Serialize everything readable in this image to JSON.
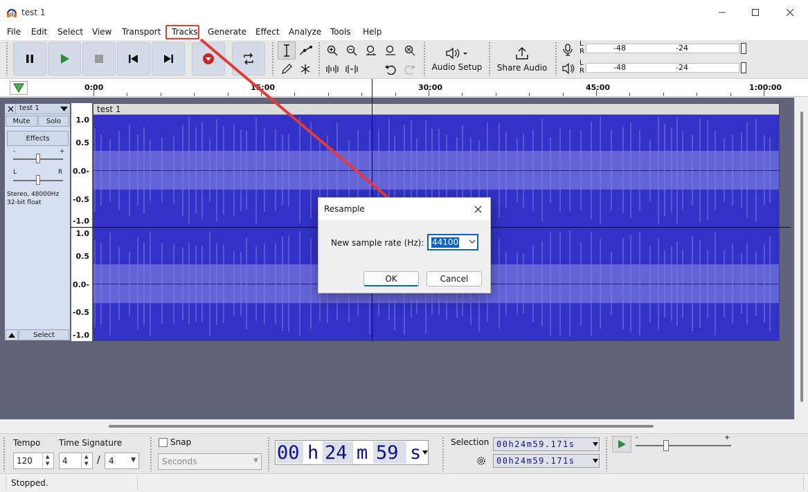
{
  "window": {
    "title": "test 1"
  },
  "menu": [
    "File",
    "Edit",
    "Select",
    "View",
    "Transport",
    "Tracks",
    "Generate",
    "Effect",
    "Analyze",
    "Tools",
    "Help"
  ],
  "toolbar": {
    "audio_setup_label": "Audio Setup",
    "share_audio_label": "Share Audio",
    "record_meter": {
      "channels": [
        "L",
        "R"
      ],
      "ticks": [
        "-48",
        "-24"
      ]
    },
    "play_meter": {
      "channels": [
        "L",
        "R"
      ],
      "ticks": [
        "-48",
        "-24"
      ]
    }
  },
  "ruler": {
    "labels": [
      "0:00",
      "15:00",
      "30:00",
      "45:00",
      "1:00:00"
    ]
  },
  "track": {
    "name": "test 1",
    "mute_label": "Mute",
    "solo_label": "Solo",
    "effects_label": "Effects",
    "gain_minus": "-",
    "gain_plus": "+",
    "pan_left": "L",
    "pan_right": "R",
    "info_line1": "Stereo, 48000Hz",
    "info_line2": "32-bit float",
    "select_label": "Select",
    "clip_title": "test 1",
    "scale_top": [
      "1.0",
      "0.5",
      "0.0-",
      "-0.5",
      "-1.0"
    ],
    "scale_bottom": [
      "1.0",
      "0.5",
      "0.0-",
      "-0.5",
      "-1.0"
    ]
  },
  "bottom": {
    "tempo_label": "Tempo",
    "tempo_value": "120",
    "time_signature_label": "Time Signature",
    "ts_upper": "4",
    "ts_slash": "/",
    "ts_lower": "4",
    "snap_label": "Snap",
    "snap_unit": "Seconds",
    "time": {
      "h": "00",
      "m": "24",
      "s": "59",
      "h_unit": "h",
      "m_unit": "m",
      "s_unit": "s"
    },
    "selection_label": "Selection",
    "selection_start": "00h24m59.171s",
    "selection_end": "00h24m59.171s",
    "speed_minus": "-",
    "speed_plus": "+"
  },
  "status": {
    "text": "Stopped."
  },
  "dialog": {
    "title": "Resample",
    "rate_label": "New sample rate (Hz):",
    "rate_value": "44100",
    "ok_label": "OK",
    "cancel_label": "Cancel"
  },
  "colors": {
    "waveform": "#3232c8",
    "waveform_rms": "#6464d8",
    "annotation": "#e53935",
    "accent": "#0a62c9"
  }
}
